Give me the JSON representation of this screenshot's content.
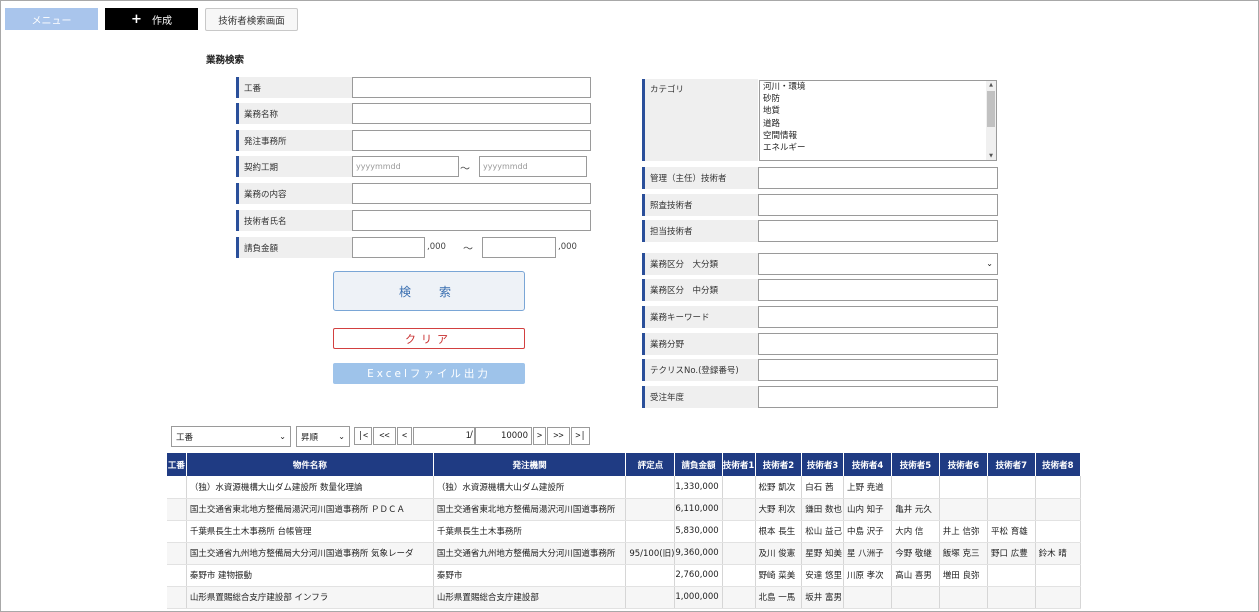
{
  "top_bar": {
    "menu_label": "メニュー",
    "create_label": "作成",
    "create_icon": "plus-icon",
    "tech_search_label": "技術者検索画面"
  },
  "section_title": "業務検索",
  "left_form": {
    "koban": "工番",
    "gyomu_name": "業務名称",
    "hacchu_office": "発注事務所",
    "keiyaku_period": "契約工期",
    "date_placeholder": "yyyymmdd",
    "range_sep": "～",
    "gyomu_content": "業務の内容",
    "engineer_name": "技術者氏名",
    "contract_amount": "請負金額",
    "amount_suffix": ",000"
  },
  "buttons": {
    "search": "検　索",
    "clear": "クリア",
    "excel": "Excelファイル出力"
  },
  "right_form": {
    "category": "カテゴリ",
    "category_options": [
      "河川・環境",
      "砂防",
      "地質",
      "道路",
      "空間情報",
      "エネルギー"
    ],
    "manager_engineer": "管理（主任）技術者",
    "check_engineer": "照査技術者",
    "charge_engineer": "担当技術者",
    "class_major": "業務区分　大分類",
    "class_middle": "業務区分　中分類",
    "keyword": "業務キーワード",
    "field": "業務分野",
    "techris_no": "テクリスNo.(登録番号)",
    "order_year": "受注年度"
  },
  "pager": {
    "sort_field": "工番",
    "sort_order": "昇順",
    "first": "|<",
    "prev_many": "<<",
    "prev": "<",
    "current_page": "1",
    "slash": "/",
    "total_pages": "10000",
    "next": ">",
    "next_many": ">>",
    "last": ">|"
  },
  "table": {
    "headers": [
      "工番",
      "物件名称",
      "発注機関",
      "評定点",
      "請負金額",
      "技術者1",
      "技術者2",
      "技術者3",
      "技術者4",
      "技術者5",
      "技術者6",
      "技術者7",
      "技術者8"
    ],
    "rows": [
      [
        "",
        "（独）水資源機構大山ダム建設所 数量化理論",
        "（独）水資源機構大山ダム建設所",
        "",
        "1,330,000",
        "",
        "松野 凱次",
        "白石 茜",
        "上野 尭道",
        "",
        "",
        "",
        ""
      ],
      [
        "",
        "国土交通省東北地方整備局湯沢河川国道事務所 ＰＤＣＡ",
        "国土交通省東北地方整備局湯沢河川国道事務所",
        "",
        "6,110,000",
        "",
        "大野 利次",
        "鎌田 数也",
        "山内 知子",
        "亀井 元久",
        "",
        "",
        ""
      ],
      [
        "",
        "千葉県長生土木事務所 台帳管理",
        "千葉県長生土木事務所",
        "",
        "5,830,000",
        "",
        "根本 長生",
        "松山 益己",
        "中島 沢子",
        "大内 信",
        "井上 信弥",
        "平松 育雄",
        ""
      ],
      [
        "",
        "国土交通省九州地方整備局大分河川国道事務所 気象レーダ",
        "国土交通省九州地方整備局大分河川国道事務所",
        "95/100(旧)",
        "9,360,000",
        "",
        "及川 俊憲",
        "星野 知美",
        "星 八洲子",
        "今野 敬継",
        "飯塚 克三",
        "野口 広豊",
        "鈴木 晴"
      ],
      [
        "",
        "秦野市 建物振動",
        "秦野市",
        "",
        "2,760,000",
        "",
        "野崎 菜美",
        "安達 悠里",
        "川原 孝次",
        "高山 喜男",
        "増田 良弥",
        "",
        ""
      ],
      [
        "",
        "山形県置賜総合支庁建設部 インフラ",
        "山形県置賜総合支庁建設部",
        "",
        "1,000,000",
        "",
        "北島 一馬",
        "坂井 富男",
        "",
        "",
        "",
        "",
        ""
      ]
    ]
  }
}
